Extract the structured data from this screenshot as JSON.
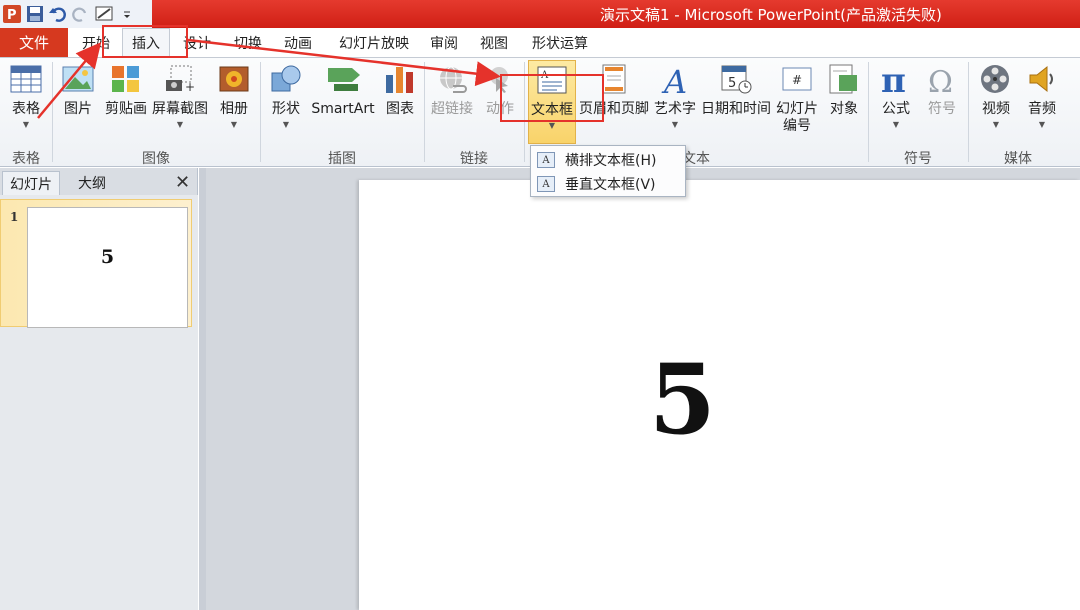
{
  "window": {
    "title": "演示文稿1 - Microsoft PowerPoint(产品激活失败)"
  },
  "quick_access": {
    "icons": [
      "powerpoint-logo-icon",
      "save-icon",
      "undo-icon",
      "redo-icon",
      "slideshow-icon",
      "customize-icon"
    ]
  },
  "tabs": {
    "file": "文件",
    "items": [
      {
        "label": "开始"
      },
      {
        "label": "插入"
      },
      {
        "label": "设计"
      },
      {
        "label": "切换"
      },
      {
        "label": "动画"
      },
      {
        "label": "幻灯片放映"
      },
      {
        "label": "审阅"
      },
      {
        "label": "视图"
      },
      {
        "label": "形状运算"
      }
    ],
    "active_index": 1
  },
  "ribbon": {
    "groups": [
      {
        "label": "表格"
      },
      {
        "label": "图像"
      },
      {
        "label": "插图"
      },
      {
        "label": "链接"
      },
      {
        "label": "文本"
      },
      {
        "label": "符号"
      },
      {
        "label": "媒体"
      }
    ],
    "buttons": [
      {
        "label": "表格"
      },
      {
        "label": "图片"
      },
      {
        "label": "剪贴画"
      },
      {
        "label": "屏幕截图"
      },
      {
        "label": "相册"
      },
      {
        "label": "形状"
      },
      {
        "label": "SmartArt"
      },
      {
        "label": "图表"
      },
      {
        "label": "超链接"
      },
      {
        "label": "动作"
      },
      {
        "label": "文本框"
      },
      {
        "label": "页眉和页脚"
      },
      {
        "label": "艺术字"
      },
      {
        "label": "日期和时间"
      },
      {
        "label": "幻灯片编号"
      },
      {
        "label": "对象"
      },
      {
        "label": "公式"
      },
      {
        "label": "符号"
      },
      {
        "label": "视频"
      },
      {
        "label": "音频"
      }
    ]
  },
  "textbox_menu": {
    "items": [
      {
        "label": "横排文本框(H)"
      },
      {
        "label": "垂直文本框(V)"
      }
    ]
  },
  "left_panel": {
    "tabs": [
      "幻灯片",
      "大纲"
    ],
    "slides": [
      {
        "number": "1",
        "text": "5"
      }
    ]
  },
  "slide": {
    "text": "5"
  },
  "colors": {
    "titlebar": "#d01f15",
    "file_tab": "#d6391f",
    "annotation": "#e5322b",
    "selected_button": "#f9d36a"
  }
}
